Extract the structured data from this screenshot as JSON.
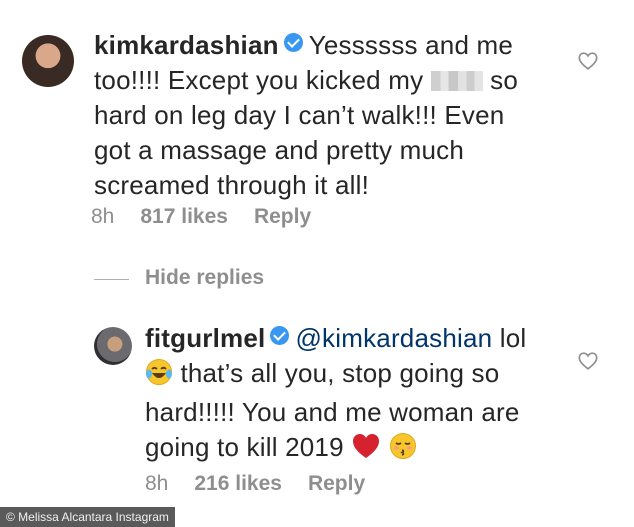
{
  "comments": [
    {
      "username": "kimkardashian",
      "text_before_blur": "Yessssss and me too!!!! Except you kicked my",
      "text_after_blur": "so hard on leg day I can’t walk!!! Even got a massage and pretty much screamed through it all!",
      "time": "8h",
      "likes": "817 likes",
      "reply": "Reply",
      "like_icon": "heart-outline-icon"
    },
    {
      "username": "fitgurlmel",
      "mention": "@kimkardashian",
      "text_part1": "lol",
      "text_part2": "that’s all you, stop going so hard!!!!! You and me woman are going to kill 2019",
      "time": "8h",
      "likes": "216 likes",
      "reply": "Reply",
      "like_icon": "heart-outline-icon"
    }
  ],
  "hide_replies": "Hide replies",
  "credit": "© Melissa Alcantara Instagram",
  "colors": {
    "verified": "#3897f0",
    "mention": "#003569",
    "muted": "#8e8e8e"
  }
}
